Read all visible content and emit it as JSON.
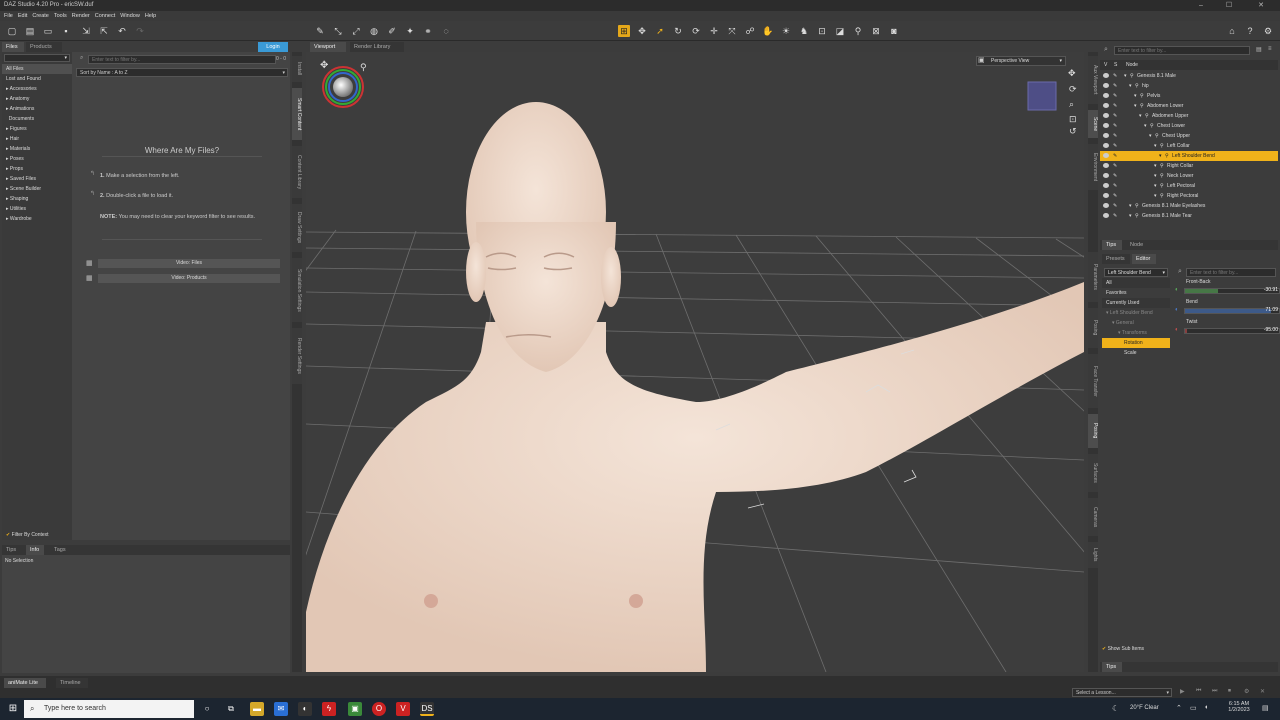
{
  "title": "DAZ Studio 4.20 Pro - ericSW.duf",
  "menu": [
    "File",
    "Edit",
    "Create",
    "Tools",
    "Render",
    "Connect",
    "Window",
    "Help"
  ],
  "left_tabs": {
    "files": "Files",
    "products": "Products",
    "login": "Login"
  },
  "category_dropdown": "",
  "categories": [
    "All Files",
    "Lost and Found",
    "Accessories",
    "Anatomy",
    "Animations",
    "Documents",
    "Figures",
    "Hair",
    "Materials",
    "Poses",
    "Props",
    "Saved Files",
    "Scene Builder",
    "Shaping",
    "Utilities",
    "Wardrobe"
  ],
  "filter_placeholder": "Enter text to filter by...",
  "filter_count": "0 - 0",
  "sort_label": "Sort by Name : A to Z",
  "help": {
    "heading": "Where Are My Files?",
    "step1_num": "1.",
    "step1": "Make a selection from the left.",
    "step2_num": "2.",
    "step2": "Double-click a file to load it.",
    "note_label": "NOTE:",
    "note": "You may need to clear your keyword filter to see results.",
    "video_files": "Video: Files",
    "video_products": "Video: Products"
  },
  "filter_context": "Filter By Context",
  "info_tabs": [
    "Tips",
    "Info",
    "Tags"
  ],
  "no_selection": "No Selection",
  "left_vtabs": [
    "Install",
    "Smart Content",
    "Content Library",
    "Draw Settings",
    "Simulation Settings",
    "Render Settings"
  ],
  "viewport_tabs": {
    "viewport": "Viewport",
    "render_library": "Render Library"
  },
  "view_select": "Perspective View",
  "right_vtabs": [
    "Aux Viewport",
    "Scene",
    "Environment",
    "Parameters",
    "Posing",
    "Face Transfer",
    "Posing",
    "Surfaces",
    "Cameras",
    "Lights"
  ],
  "scene": {
    "filter_placeholder": "Enter text to filter by...",
    "col_v": "V",
    "col_s": "S",
    "col_node": "Node",
    "nodes": [
      {
        "label": "Genesis 8.1 Male",
        "depth": 0
      },
      {
        "label": "hip",
        "depth": 1
      },
      {
        "label": "Pelvis",
        "depth": 2
      },
      {
        "label": "Abdomen Lower",
        "depth": 2
      },
      {
        "label": "Abdomen Upper",
        "depth": 3
      },
      {
        "label": "Chest Lower",
        "depth": 4
      },
      {
        "label": "Chest Upper",
        "depth": 5
      },
      {
        "label": "Left Collar",
        "depth": 6
      },
      {
        "label": "Left Shoulder Bend",
        "depth": 7
      },
      {
        "label": "Right Collar",
        "depth": 6
      },
      {
        "label": "Neck Lower",
        "depth": 6
      },
      {
        "label": "Left Pectoral",
        "depth": 6
      },
      {
        "label": "Right Pectoral",
        "depth": 6
      },
      {
        "label": "Genesis 8.1 Male Eyelashes",
        "depth": 1
      },
      {
        "label": "Genesis 8.1 Male Tear",
        "depth": 1
      }
    ],
    "selected": "Left Shoulder Bend"
  },
  "mid_tabs": [
    "Tips",
    "Node"
  ],
  "param_tabs": [
    "Presets",
    "Editor"
  ],
  "param_node": "Left Shoulder Bend",
  "param_filter_placeholder": "Enter text to filter by...",
  "param_tree": [
    "All",
    "Favorites",
    "Currently Used",
    "Left Shoulder Bend",
    "General",
    "Transforms",
    "Rotation",
    "Scale"
  ],
  "params": [
    {
      "label": "Front-Back",
      "value": "-30.91",
      "fraction": 0.35,
      "color": "#5bb55b"
    },
    {
      "label": "Bend",
      "value": "71.09",
      "fraction": 0.92,
      "color": "#4a7fd6"
    },
    {
      "label": "Twist",
      "value": "-95.00",
      "fraction": 0.02,
      "color": "#d05050"
    }
  ],
  "show_sub_items": "Show Sub Items",
  "bottom_tip": "Tips",
  "bottom_tabs": [
    "aniMate Lite",
    "Timeline"
  ],
  "lesson": "Select a Lesson...",
  "taskbar": {
    "search": "Type here to search",
    "weather": "20°F  Clear",
    "time": "6:15 AM",
    "date": "1/2/2023",
    "ds": "DS"
  },
  "colors": {
    "accent": "#f0b21a",
    "blue": "#3a9ad6",
    "bg": "#3c3c3c"
  }
}
